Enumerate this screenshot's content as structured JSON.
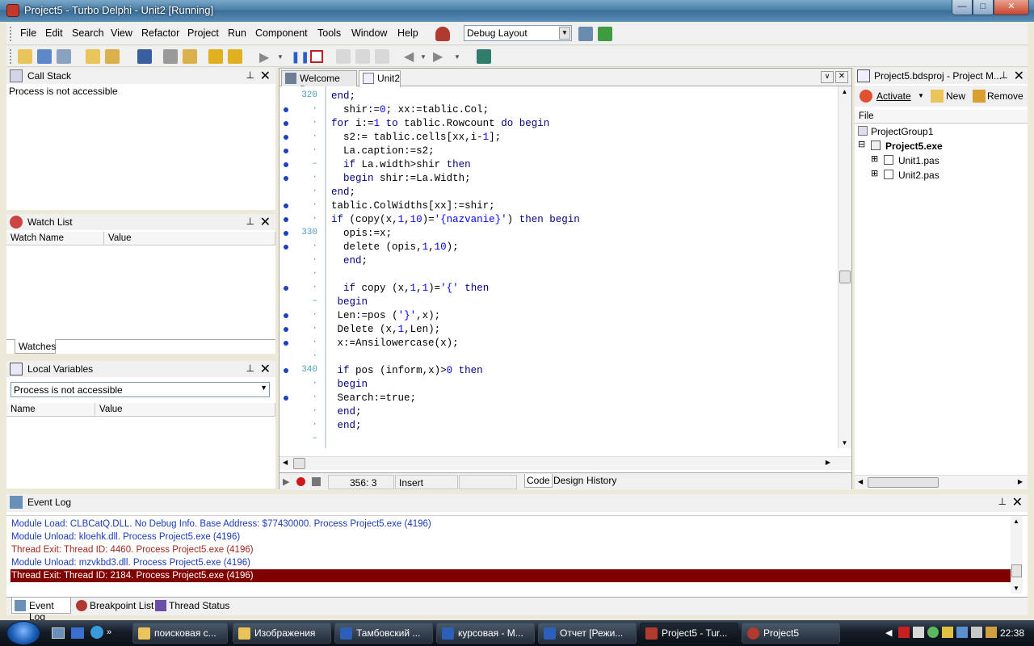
{
  "window": {
    "title": "Project5 - Turbo Delphi - Unit2 [Running]",
    "buttons": {
      "minimize": "—",
      "maximize": "□",
      "close": "✕"
    }
  },
  "menu": {
    "items": [
      "File",
      "Edit",
      "Search",
      "View",
      "Refactor",
      "Project",
      "Run",
      "Component",
      "Tools",
      "Window",
      "Help"
    ],
    "layout_combo": "Debug Layout"
  },
  "call_stack": {
    "title": "Call Stack",
    "message": "Process is not accessible"
  },
  "watch_list": {
    "title": "Watch List",
    "columns": [
      "Watch Name",
      "Value"
    ],
    "tab": "Watches"
  },
  "local_variables": {
    "title": "Local Variables",
    "combo": "Process is not accessible",
    "columns": [
      "Name",
      "Value"
    ]
  },
  "editor": {
    "tabs": [
      "Welcome Page",
      "Unit2"
    ],
    "line_numbers": [
      {
        "row": 0,
        "text": "320"
      },
      {
        "row": 1,
        "text": "·"
      },
      {
        "row": 2,
        "text": "·"
      },
      {
        "row": 3,
        "text": "·"
      },
      {
        "row": 4,
        "text": "·"
      },
      {
        "row": 5,
        "text": "–"
      },
      {
        "row": 6,
        "text": "·"
      },
      {
        "row": 7,
        "text": "·"
      },
      {
        "row": 8,
        "text": "·"
      },
      {
        "row": 9,
        "text": "·"
      },
      {
        "row": 10,
        "text": "330"
      },
      {
        "row": 11,
        "text": "·"
      },
      {
        "row": 12,
        "text": "·"
      },
      {
        "row": 13,
        "text": "·"
      },
      {
        "row": 14,
        "text": "·"
      },
      {
        "row": 15,
        "text": "–"
      },
      {
        "row": 16,
        "text": "·"
      },
      {
        "row": 17,
        "text": "·"
      },
      {
        "row": 18,
        "text": "·"
      },
      {
        "row": 19,
        "text": "·"
      },
      {
        "row": 20,
        "text": "340"
      },
      {
        "row": 21,
        "text": "·"
      },
      {
        "row": 22,
        "text": "·"
      },
      {
        "row": 23,
        "text": "·"
      },
      {
        "row": 24,
        "text": "·"
      },
      {
        "row": 25,
        "text": "–"
      }
    ],
    "breakpoint_rows": [
      1,
      2,
      3,
      4,
      5,
      6,
      8,
      9,
      10,
      11,
      14,
      16,
      17,
      18,
      20,
      22
    ],
    "code_lines": [
      "end;",
      "  shir:=0; xx:=tablic.Col;",
      "for i:=1 to tablic.Rowcount do begin",
      "  s2:= tablic.cells[xx,i-1];",
      "  La.caption:=s2;",
      "  if La.width>shir then",
      "  begin shir:=La.Width;",
      "end;",
      "tablic.ColWidths[xx]:=shir;",
      "if (copy(x,1,10)='{nazvanie}') then begin",
      "  opis:=x;",
      "  delete (opis,1,10);",
      "  end;",
      "",
      "  if copy (x,1,1)='{' then",
      " begin",
      " Len:=pos ('}',x);",
      " Delete (x,1,Len);",
      " x:=Ansilowercase(x);",
      "",
      " if pos (inform,x)>0 then",
      " begin",
      " Search:=true;",
      " end;",
      " end;",
      ""
    ],
    "status": {
      "position": "356:  3",
      "mode": "Insert"
    },
    "bottom_tabs": [
      "Code",
      "Design",
      "History"
    ]
  },
  "project_manager": {
    "title": "Project5.bdsproj - Project M...",
    "toolbar": {
      "activate": "Activate",
      "new": "New",
      "remove": "Remove"
    },
    "column": "File",
    "tree": [
      {
        "label": "ProjectGroup1",
        "level": 0,
        "bold": false
      },
      {
        "label": "Project5.exe",
        "level": 1,
        "bold": true
      },
      {
        "label": "Unit1.pas",
        "level": 2,
        "bold": false
      },
      {
        "label": "Unit2.pas",
        "level": 2,
        "bold": false
      }
    ]
  },
  "event_log": {
    "title": "Event Log",
    "lines": [
      {
        "text": "Module Load: CLBCatQ.DLL. No Debug Info. Base Address: $77430000. Process Project5.exe (4196)",
        "kind": "blue"
      },
      {
        "text": "Module Unload: kloehk.dll. Process Project5.exe (4196)",
        "kind": "blue"
      },
      {
        "text": "Thread Exit: Thread ID: 4460. Process Project5.exe (4196)",
        "kind": "red"
      },
      {
        "text": "Module Unload: mzvkbd3.dll. Process Project5.exe (4196)",
        "kind": "blue"
      },
      {
        "text": "Thread Exit: Thread ID: 2184. Process Project5.exe (4196)",
        "kind": "sel"
      }
    ],
    "tabs": [
      "Event Log",
      "Breakpoint List",
      "Thread Status"
    ]
  },
  "taskbar": {
    "buttons": [
      "поисковая с...",
      "Изображения",
      "Тамбовский ...",
      "курсовая - М...",
      "Отчет [Режи...",
      "Project5 - Tur...",
      "Project5"
    ],
    "clock": "22:38"
  }
}
